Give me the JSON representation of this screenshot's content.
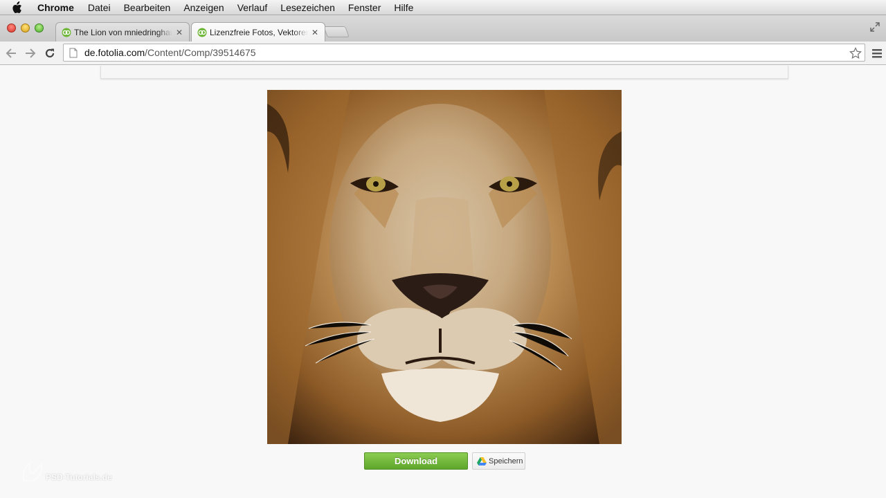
{
  "menubar": {
    "apple_icon": "apple-logo-icon",
    "app_name": "Chrome",
    "items": [
      "Datei",
      "Bearbeiten",
      "Anzeigen",
      "Verlauf",
      "Lesezeichen",
      "Fenster",
      "Hilfe"
    ]
  },
  "tabs": [
    {
      "title": "The Lion von mniedringhaus",
      "active": false,
      "icon": "fotolia-favicon-icon"
    },
    {
      "title": "Lizenzfreie Fotos, Vektoren",
      "active": true,
      "icon": "fotolia-favicon-icon"
    }
  ],
  "address_bar": {
    "host": "de.fotolia.com",
    "path": "/Content/Comp/39514675"
  },
  "page": {
    "image_subject": "lion face",
    "download_label": "Download",
    "save_label": "Speichern"
  },
  "watermark": {
    "text": "PSD-Tutorials.de"
  },
  "colors": {
    "download_green": "#6cb535",
    "menubar": "#e6e6e6",
    "page_bg": "#f8f8f8"
  }
}
